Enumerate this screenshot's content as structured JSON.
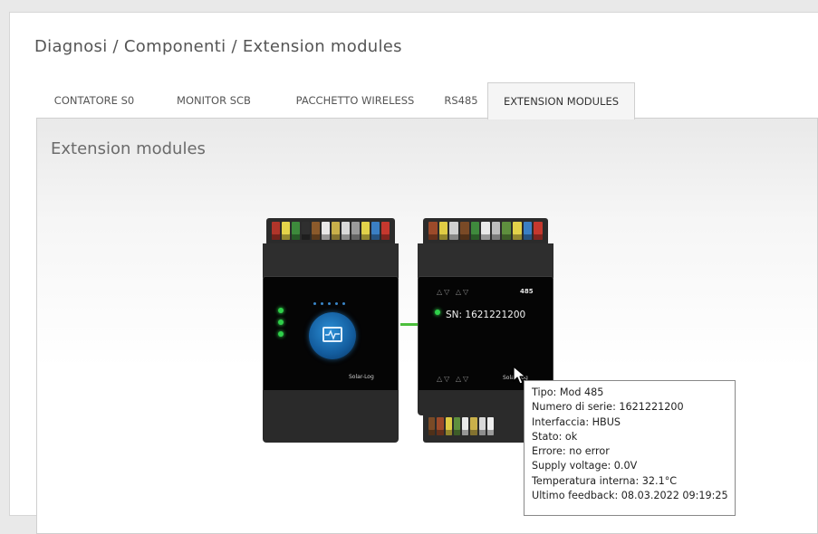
{
  "breadcrumb": "Diagnosi / Componenti / Extension modules",
  "tabs": [
    {
      "label": "CONTATORE S0",
      "active": false
    },
    {
      "label": "MONITOR SCB",
      "active": false
    },
    {
      "label": "PACCHETTO WIRELESS",
      "active": false
    },
    {
      "label": "RS485",
      "active": false
    },
    {
      "label": "EXTENSION MODULES",
      "active": true
    }
  ],
  "panel": {
    "title": "Extension modules"
  },
  "devices": {
    "main": {
      "brand": "Solar-Log",
      "led_count": 3,
      "icon": "monitor-pulse-icon"
    },
    "module": {
      "label": "485",
      "sn": "SN: 1621221200",
      "arrows_top": "△▽  △▽",
      "arrows_bottom": "△▽  △▽",
      "brand": "Solar-Log"
    }
  },
  "pin_colors_main": [
    "#b0352a",
    "#e4d44a",
    "#3d8a3c",
    "#2f2f2f",
    "#8b5a2b",
    "#e8e8e8",
    "#c9b04a",
    "#d9d9d9",
    "#9a9a9a",
    "#e2d24a",
    "#3b7fc4",
    "#c6382e"
  ],
  "pin_colors_module": [
    "#9c4a2a",
    "#e0cc44",
    "#d0d0d0",
    "#7a4a26",
    "#3f8a3d",
    "#e9e9e9",
    "#bdbdbd",
    "#5e8f3e",
    "#e3d14a",
    "#3b7fc4",
    "#c4382e"
  ],
  "pin_colors_bottom": [
    "#7a4a26",
    "#9c4a2a",
    "#e0cc44",
    "#5e8f3e",
    "#e9e9e9",
    "#c9b04a",
    "#d9d9d9",
    "#eeeeee"
  ],
  "tooltip": {
    "lines": [
      "Tipo: Mod 485",
      "Numero di serie: 1621221200",
      "Interfaccia: HBUS",
      "Stato: ok",
      "Errore: no error",
      "Supply voltage: 0.0V",
      "Temperatura interna: 32.1°C",
      "Ultimo feedback: 08.03.2022 09:19:25"
    ]
  }
}
